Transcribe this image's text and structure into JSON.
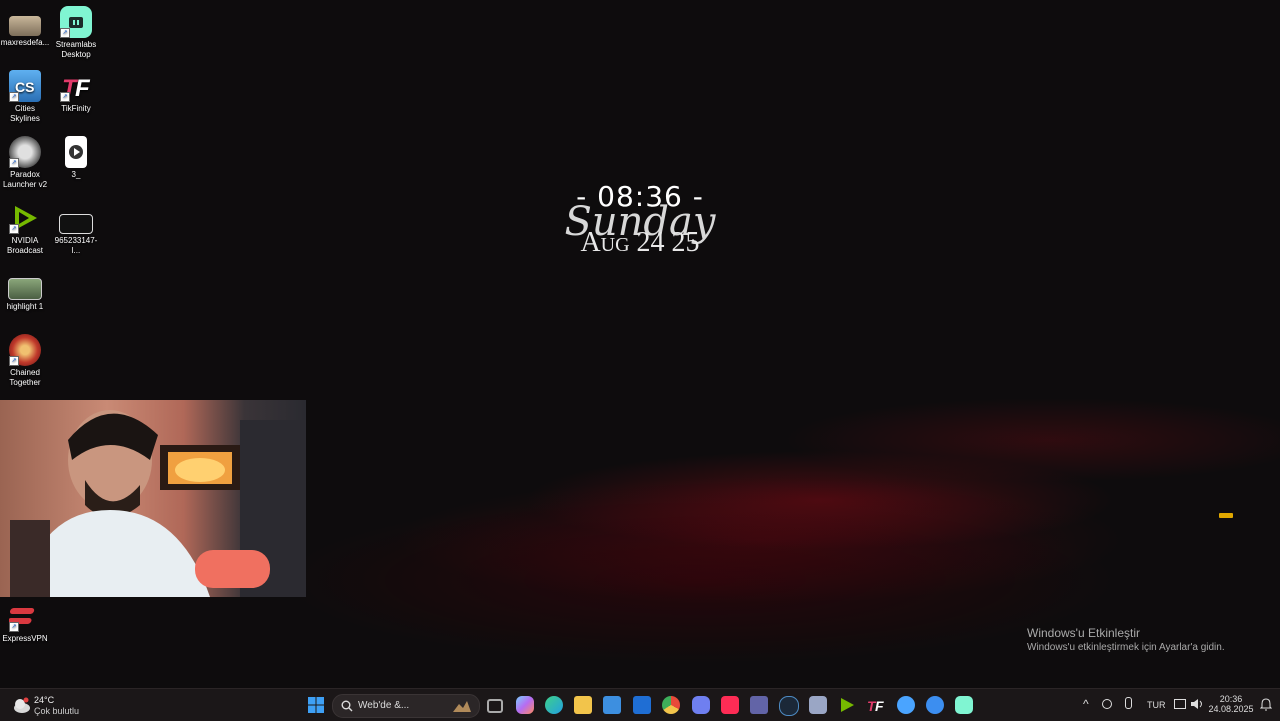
{
  "desktop": {
    "icons": [
      {
        "label": "maxresdefa...",
        "color": "#c9b79a"
      },
      {
        "label": "Streamlabs Desktop",
        "color": "#80f5d2"
      },
      {
        "label": "Cities Skylines",
        "color": "#3a8ad6"
      },
      {
        "label": "TikFinity",
        "color": "#ffffff"
      },
      {
        "label": "Paradox Launcher v2",
        "color": "#bfbfbf"
      },
      {
        "label": "3_",
        "color": "#ffffff"
      },
      {
        "label": "NVIDIA Broadcast",
        "color": "#76b900"
      },
      {
        "label": "965233147-l...",
        "color": "#222222"
      },
      {
        "label": "highlight 1",
        "color": "#6b8a5a"
      },
      {
        "label": "Chained Together",
        "color": "#c0392b"
      },
      {
        "label": "ExpressVPN",
        "color": "#da3940"
      }
    ]
  },
  "clock": {
    "time": "- 08:36 -",
    "day": "Sunday",
    "date": "Aug 24 25"
  },
  "activation": {
    "title": "Windows'u Etkinleştir",
    "subtitle": "Windows'u etkinleştirmek için Ayarlar'a gidin."
  },
  "taskbar": {
    "weather": {
      "temp": "24°C",
      "desc": "Çok bulutlu"
    },
    "search_placeholder": "Web'de &...",
    "apps": [
      {
        "name": "start-button",
        "color": "#3ea0f5"
      },
      {
        "name": "task-view",
        "color": "#8a8a8a"
      },
      {
        "name": "copilot",
        "color": "#b66cf2"
      },
      {
        "name": "edge",
        "color": "#23a0e0"
      },
      {
        "name": "file-explorer",
        "color": "#f2c44b"
      },
      {
        "name": "store",
        "color": "#3d8fe0"
      },
      {
        "name": "outlook",
        "color": "#1f6ed4"
      },
      {
        "name": "chrome",
        "color": "#e84a3a"
      },
      {
        "name": "discord",
        "color": "#6f7ff0"
      },
      {
        "name": "tiktok",
        "color": "#fe2c55"
      },
      {
        "name": "teams",
        "color": "#6264a7"
      },
      {
        "name": "steam",
        "color": "#4d8ac2"
      },
      {
        "name": "settings-app",
        "color": "#9aa6c5"
      },
      {
        "name": "nvidia-app",
        "color": "#76b900"
      },
      {
        "name": "tikfinity",
        "color": "#ffffff"
      },
      {
        "name": "browser-blue",
        "color": "#4aa4ff"
      },
      {
        "name": "browser-blue-2",
        "color": "#3c8ef0"
      },
      {
        "name": "streamlabs",
        "color": "#80f5d2"
      }
    ],
    "tray": {
      "lang": "TUR",
      "time": "20:36",
      "date": "24.08.2025"
    }
  }
}
